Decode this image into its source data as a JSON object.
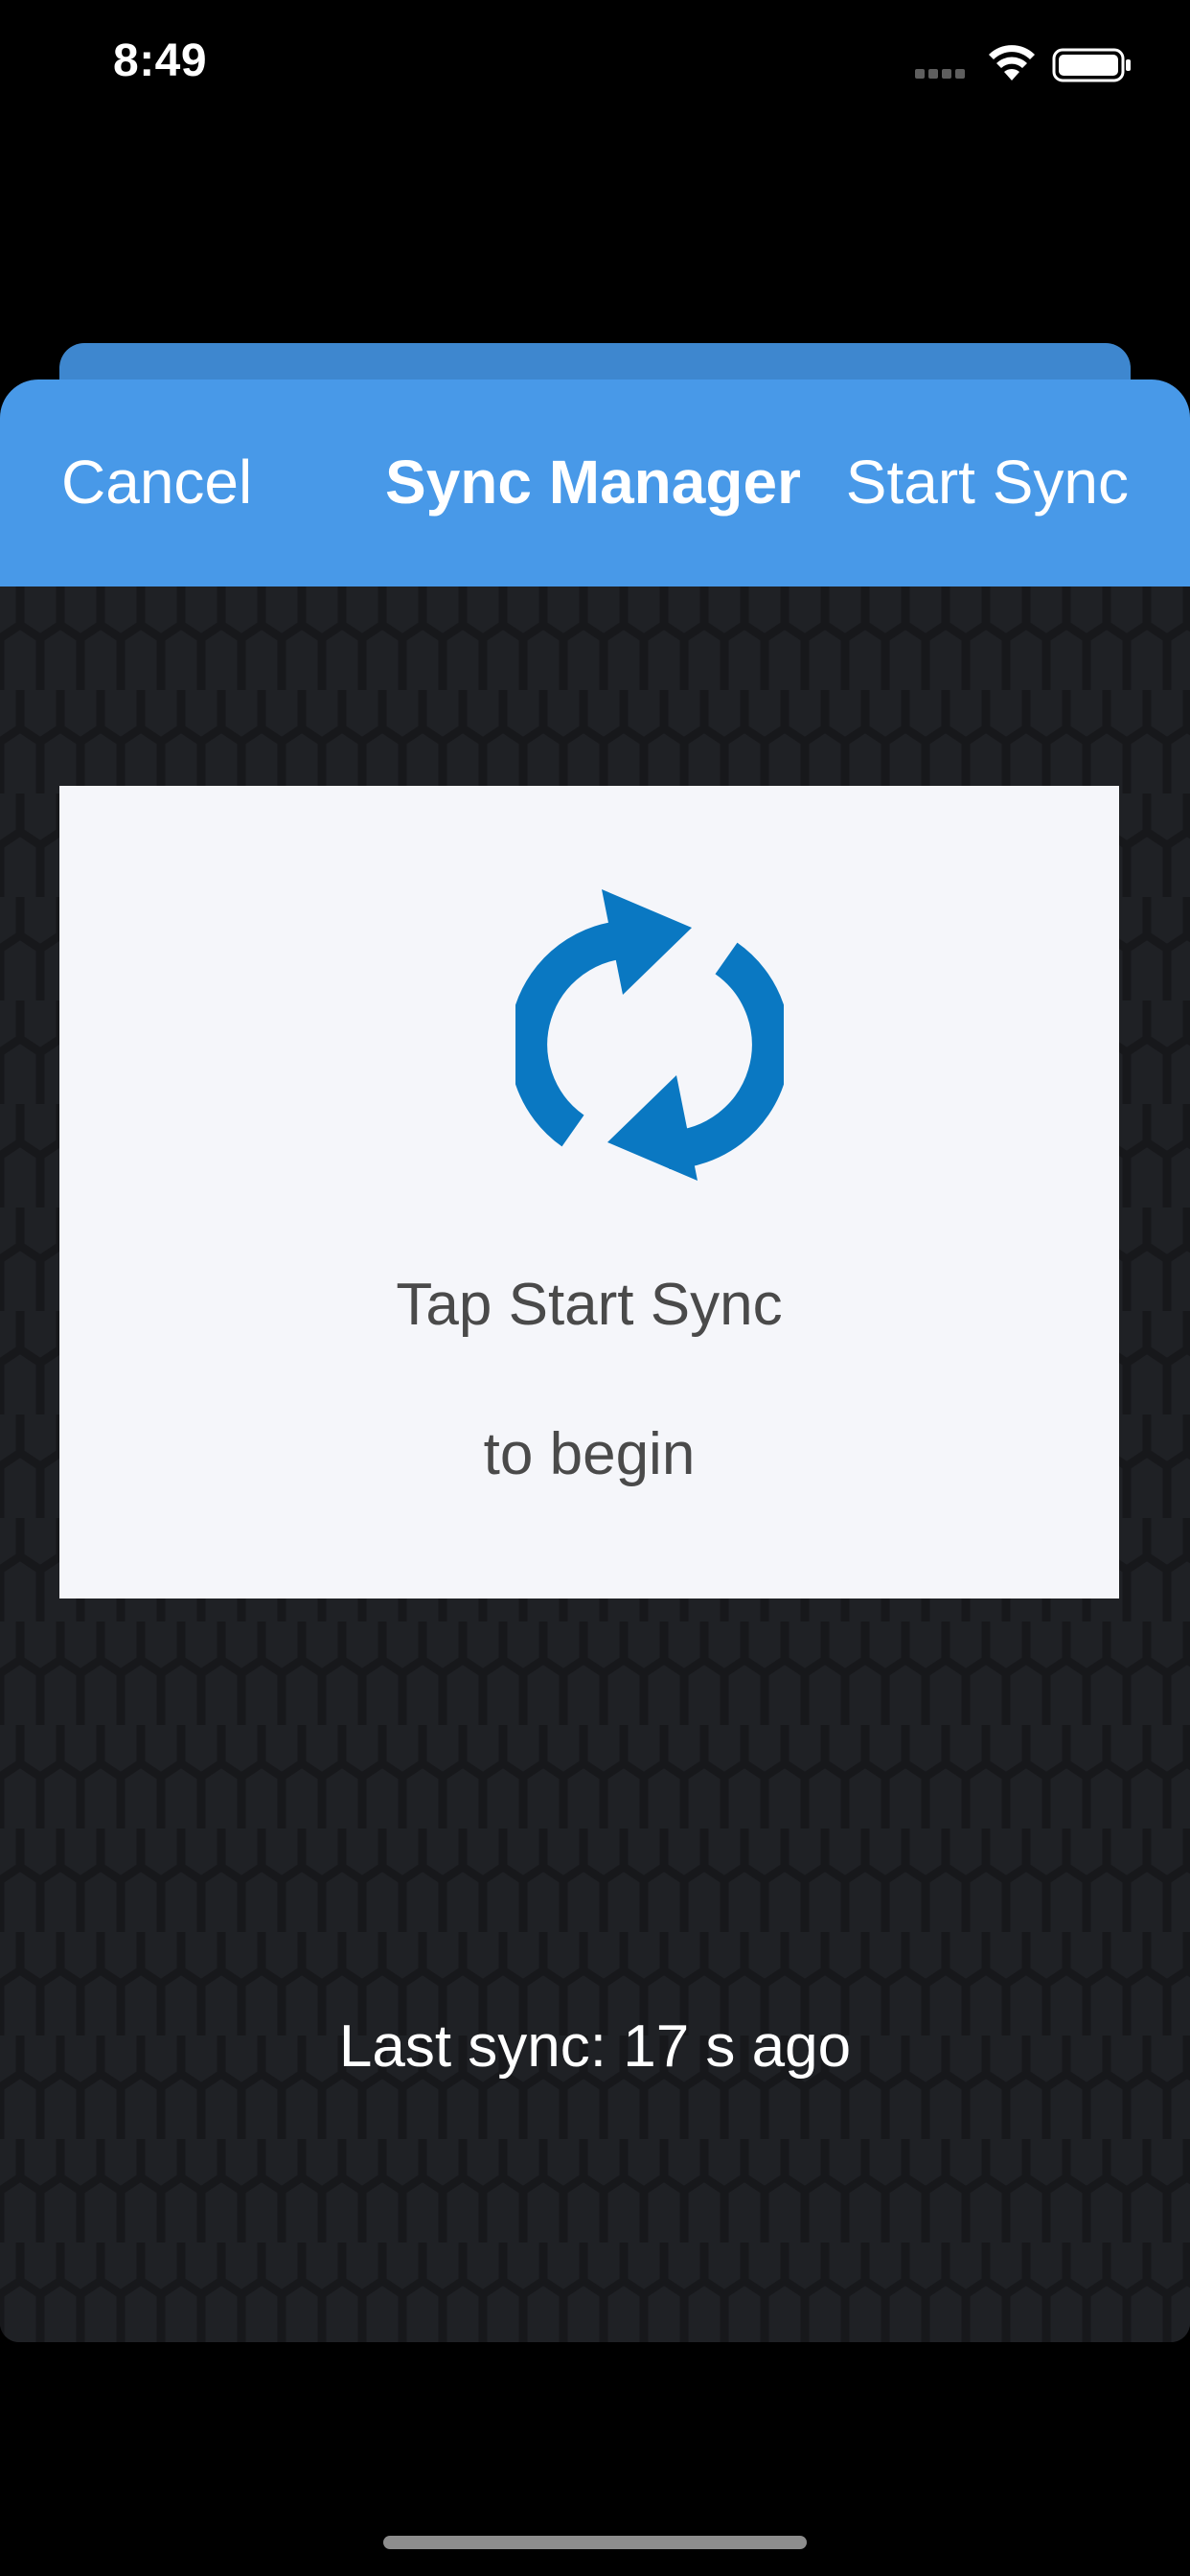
{
  "status_bar": {
    "time": "8:49"
  },
  "nav": {
    "cancel_label": "Cancel",
    "title": "Sync Manager",
    "start_label": "Start Sync"
  },
  "card": {
    "icon": "sync-arrows-icon",
    "line1": "Tap Start Sync",
    "line2": "to begin"
  },
  "footer": {
    "last_sync": "Last sync: 17 s ago"
  },
  "colors": {
    "nav_background": "#4899e8",
    "back_card": "#3e87cf",
    "sync_icon": "#0a78c2",
    "card_background": "#f5f6fa",
    "pattern_background": "#1f2125"
  }
}
